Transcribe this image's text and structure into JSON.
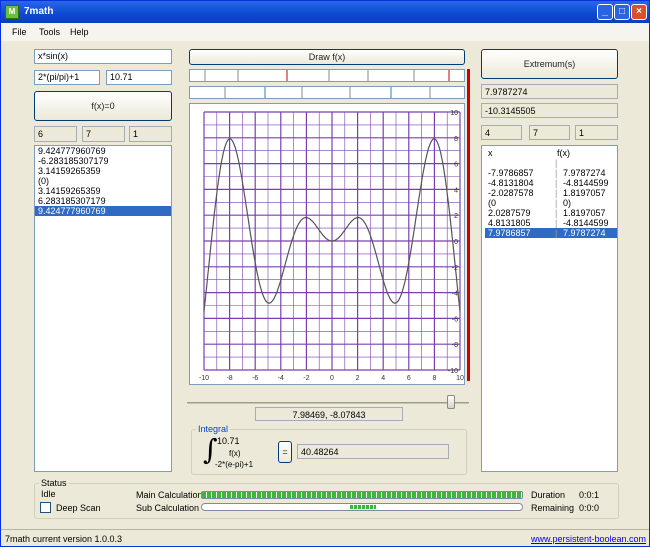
{
  "window": {
    "title": "7math"
  },
  "menu": [
    "File",
    "Tools",
    "Help"
  ],
  "left": {
    "function_input": "x*sin(x)",
    "from_input": "2*(pi/pi)+1",
    "to_input": "10.71",
    "button_label": "f(x)=0",
    "params": [
      "6",
      "7",
      "1"
    ],
    "roots": [
      "9.424777960769",
      "-6.283185307179",
      "3.14159265359",
      "(0)",
      "3.14159265359",
      "6.283185307179",
      "9.424777960769"
    ],
    "selected_index": 6
  },
  "center": {
    "draw_button": "Draw f(x)",
    "y_ticks": [
      "10",
      "8",
      "6",
      "4",
      "2",
      "0",
      "-2",
      "-4",
      "-6",
      "-8",
      "-10"
    ],
    "x_ticks": [
      "-10",
      "-8",
      "-6",
      "-4",
      "-2",
      "0",
      "2",
      "4",
      "6",
      "8",
      "10"
    ],
    "coords_readout": "7.98469, -8.07843",
    "slider_value": 0.95
  },
  "right": {
    "button_label": "Extremum(s)",
    "value1": "7.9787274",
    "value2": "-10.3145505",
    "params": [
      "4",
      "7",
      "1"
    ],
    "col_x": "x",
    "col_fx": "f(x)",
    "rows": [
      [
        "",
        ""
      ],
      [
        "-7.9786857",
        "7.9787274"
      ],
      [
        "-4.8131804",
        "-4.8144599"
      ],
      [
        "-2.0287578",
        "1.8197057"
      ],
      [
        "(0",
        "0)"
      ],
      [
        "2.0287579",
        "1.8197057"
      ],
      [
        "4.8131805",
        "-4.8144599"
      ],
      [
        "7.9786857",
        "7.9787274"
      ]
    ],
    "selected_index": 7
  },
  "integral": {
    "label": "Integral",
    "upper": "10.71",
    "integrand": "f(x)",
    "lower": "-2*(e-pi)+1",
    "compute_button": "=",
    "result": "40.48264"
  },
  "status": {
    "label": "Status",
    "state": "Idle",
    "deep_scan_label": "Deep Scan",
    "deep_scan_checked": false,
    "main_calc_label": "Main Calculation",
    "main_calc_progress": 1.0,
    "sub_calc_label": "Sub Calculation",
    "sub_calc_progress": 0.08,
    "duration_label": "Duration",
    "duration_value": "0:0:1",
    "remaining_label": "Remaining",
    "remaining_value": "0:0:0"
  },
  "footer": {
    "version": "7math current version 1.0.0.3",
    "link": "www.persistent-boolean.com"
  }
}
